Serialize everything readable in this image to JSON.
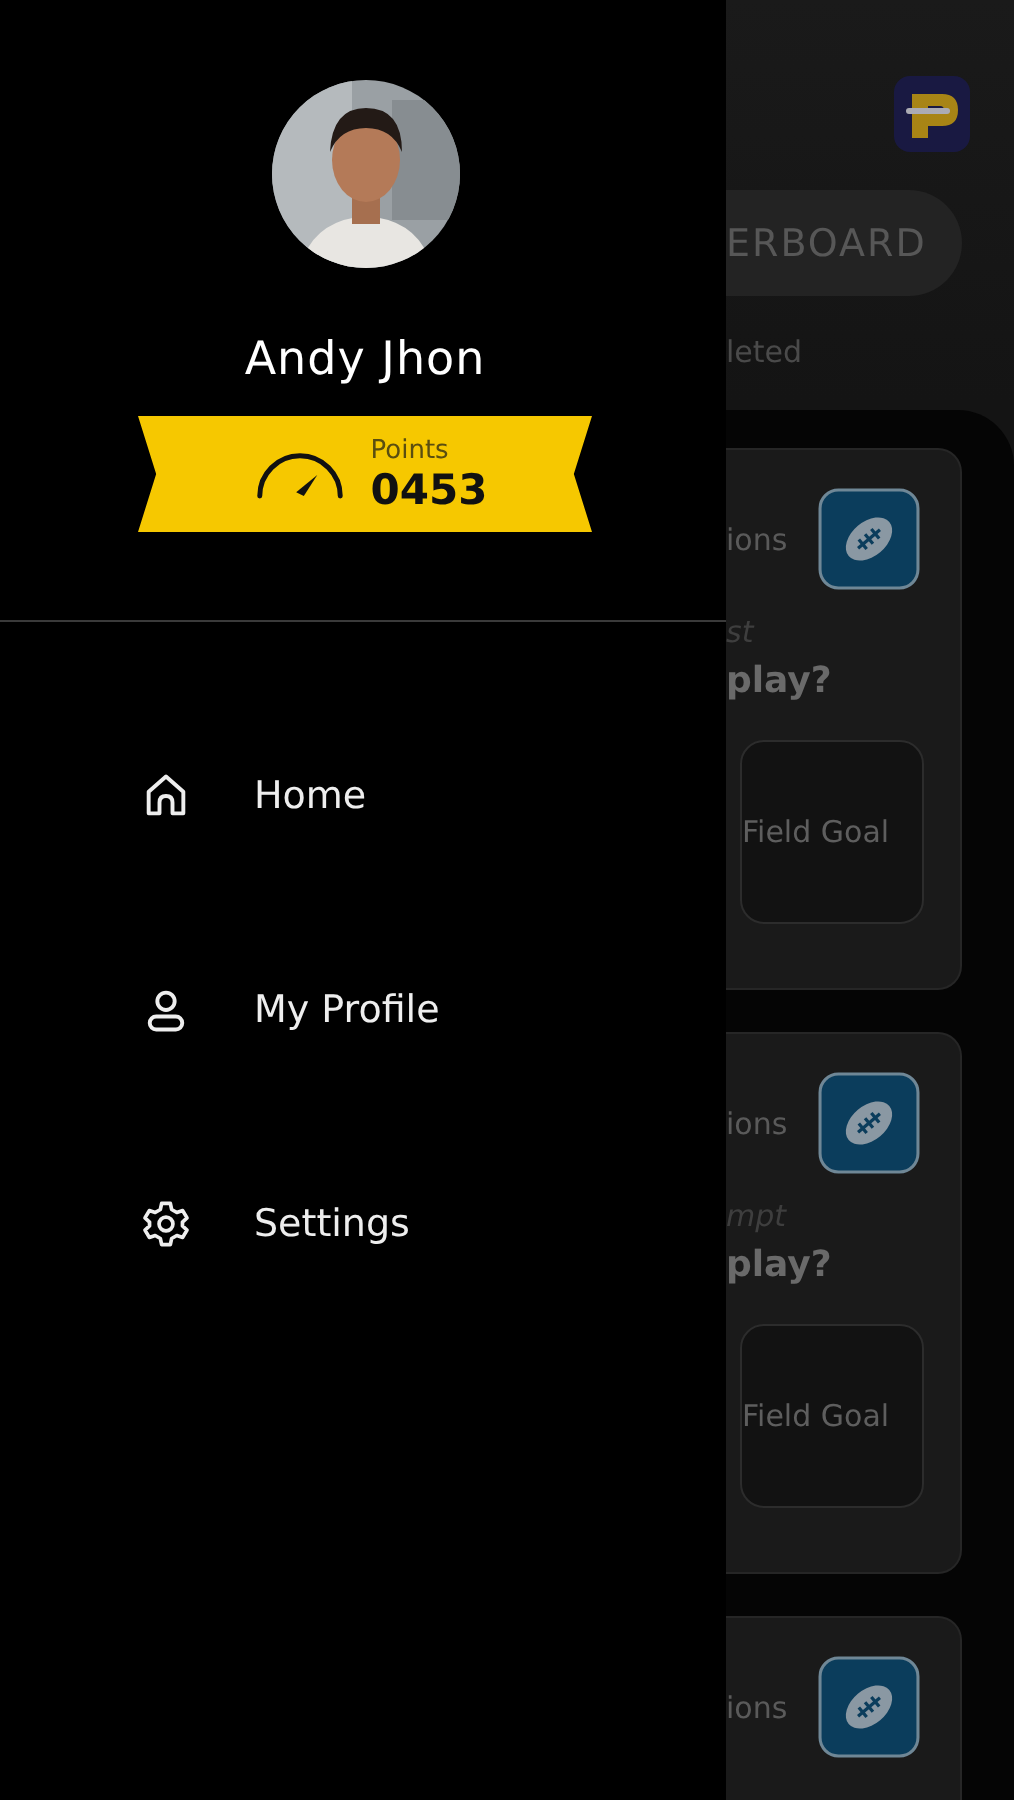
{
  "drawer": {
    "profile": {
      "name": "Andy Jhon",
      "points_label": "Points",
      "points": "0453"
    },
    "menu": [
      {
        "label": "Home",
        "kind": "home"
      },
      {
        "label": "My Profile",
        "kind": "profile"
      },
      {
        "label": "Settings",
        "kind": "settings"
      }
    ]
  },
  "background": {
    "tab": "ERBOARD",
    "status": "leted",
    "cards": [
      {
        "category": "ions",
        "subtitle": "st",
        "question": "play?",
        "option": "Field Goal"
      },
      {
        "category": "ions",
        "subtitle": "mpt",
        "question": "play?",
        "option": "Field Goal"
      },
      {
        "category": "ions"
      }
    ]
  }
}
